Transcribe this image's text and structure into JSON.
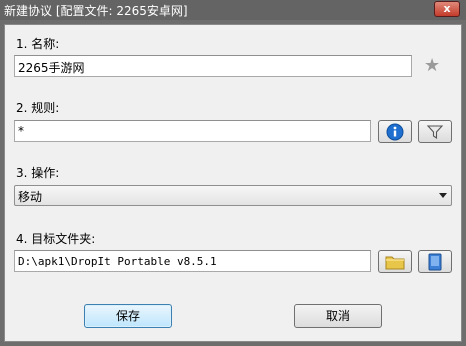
{
  "window": {
    "title": "新建协议 [配置文件: 2265安卓网]",
    "close_label": "x"
  },
  "name": {
    "label": "1. 名称:",
    "value": "2265手游网"
  },
  "rule": {
    "label": "2. 规则:",
    "value": "*"
  },
  "action": {
    "label": "3. 操作:",
    "selected": "移动"
  },
  "folder": {
    "label": "4. 目标文件夹:",
    "value": "D:\\apk1\\DropIt Portable v8.5.1"
  },
  "buttons": {
    "save": "保存",
    "cancel": "取消"
  },
  "icons": {
    "favorite": "star-icon",
    "info": "info-icon",
    "filter": "filter-icon",
    "browse": "folder-icon",
    "explore": "book-icon"
  },
  "colors": {
    "title_bar": "#646464",
    "info_blue": "#1e6fd0",
    "folder_yellow": "#e8c64a",
    "book_blue": "#3b7fd6"
  }
}
